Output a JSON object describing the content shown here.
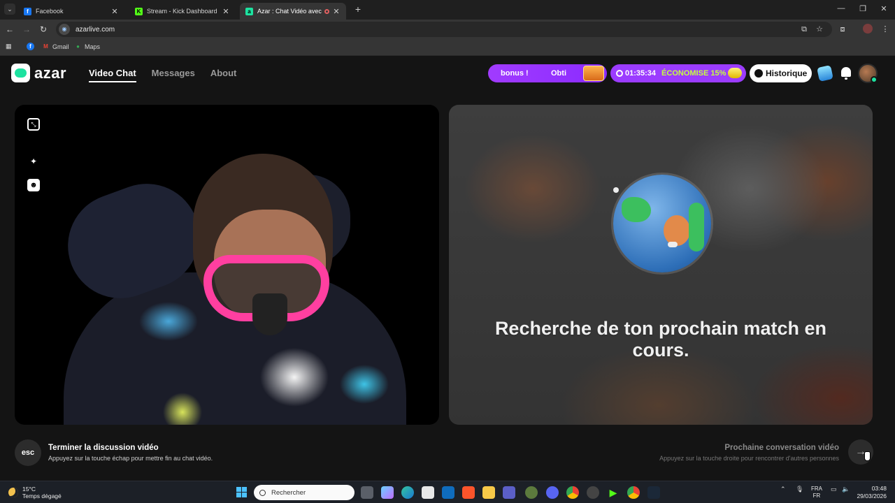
{
  "browser": {
    "tabs": [
      {
        "title": "Facebook",
        "favicon_color": "#1877f2",
        "favicon": "f"
      },
      {
        "title": "Stream - Kick Dashboard",
        "favicon_color": "#53fc18",
        "favicon": "K"
      },
      {
        "title": "Azar : Chat Vidéo avec de n",
        "favicon_color": "#1de2a0",
        "favicon": "a",
        "active": true,
        "recording": true
      }
    ],
    "url": "azarlive.com",
    "bookmarks": [
      {
        "label": "",
        "icon": "facebook-icon",
        "color": "#1877f2"
      },
      {
        "label": "Gmail",
        "icon": "gmail-icon",
        "color": "#ea4335"
      },
      {
        "label": "Maps",
        "icon": "maps-icon",
        "color": "#34a853"
      }
    ]
  },
  "header": {
    "logo_text": "azar",
    "nav": [
      {
        "label": "Video Chat",
        "active": true
      },
      {
        "label": "Messages",
        "active": false
      },
      {
        "label": "About",
        "active": false
      }
    ],
    "bonus_pill": {
      "text1": "bonus !",
      "text2": "Obti"
    },
    "timer_pill": {
      "time": "01:35:34",
      "save": "ÉCONOMISE 15%"
    },
    "history_label": "Historique"
  },
  "right_video": {
    "search_text": "Recherche de ton prochain match en cours."
  },
  "actions": {
    "end": {
      "key": "esc",
      "title": "Terminer la discussion vidéo",
      "desc": "Appuyez sur la touche échap pour mettre fin au chat vidéo."
    },
    "next": {
      "title": "Prochaine conversation vidéo",
      "desc": "Appuyez sur la touche droite pour rencontrer d'autres personnes",
      "arrow": "→"
    }
  },
  "taskbar": {
    "weather_temp": "15°C",
    "weather_desc": "Temps dégagé",
    "search_placeholder": "Rechercher",
    "lang_top": "FRA",
    "lang_bottom": "FR",
    "time": "03:48",
    "date": "29/03/2026",
    "apps": [
      "file-explorer-icon",
      "copilot-icon",
      "edge-icon",
      "store-icon",
      "outlook-icon",
      "brave-icon",
      "folder-icon",
      "teams-icon",
      "app-icon",
      "discord-icon",
      "chrome-icon",
      "app2-icon",
      "kick-icon",
      "chrome2-icon",
      "steam-icon"
    ]
  }
}
